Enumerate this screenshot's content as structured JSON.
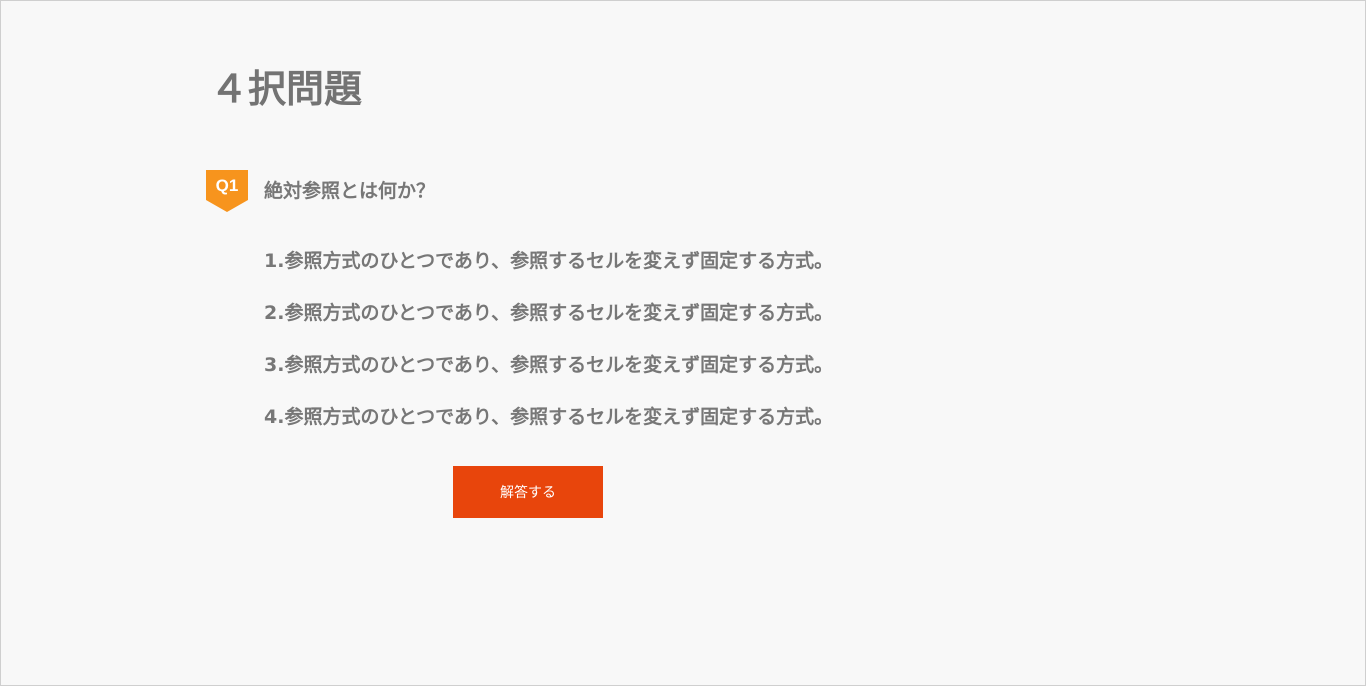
{
  "page": {
    "title": "４択問題"
  },
  "question": {
    "badge": "Q1",
    "text": "絶対参照とは何か？",
    "choices": [
      "1.参照方式のひとつであり、参照するセルを変えず固定する方式。",
      "2.参照方式のひとつであり、参照するセルを変えず固定する方式。",
      "3.参照方式のひとつであり、参照するセルを変えず固定する方式。",
      "4.参照方式のひとつであり、参照するセルを変えず固定する方式。"
    ]
  },
  "actions": {
    "submit_label": "解答する"
  },
  "colors": {
    "accent_orange": "#f7941d",
    "button_red": "#e8450c",
    "text_gray": "#777777",
    "background": "#f8f8f8"
  },
  "icons": {
    "badge_shape": "pennant-badge-icon"
  }
}
